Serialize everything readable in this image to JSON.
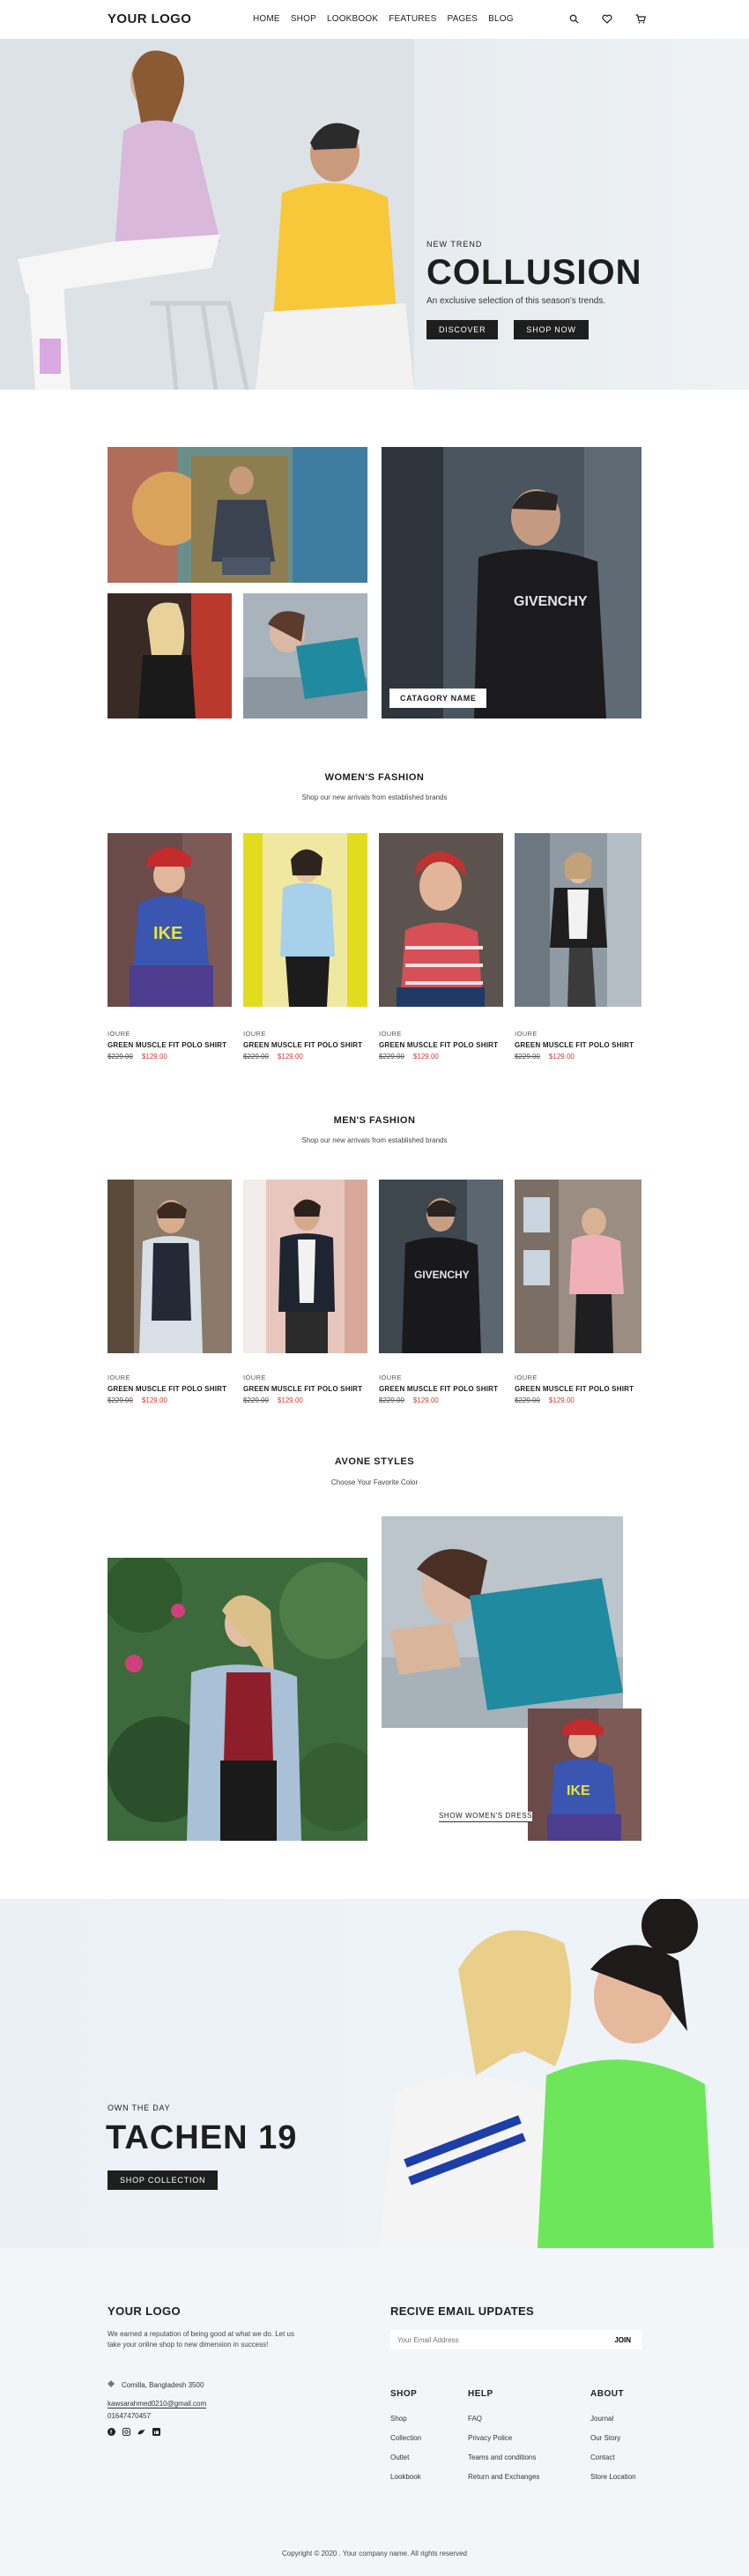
{
  "header": {
    "logo": "YOUR LOGO",
    "nav": [
      "HOME",
      "SHOP",
      "LOOKBOOK",
      "FEATURES",
      "PAGES",
      "BLOG"
    ],
    "icons": [
      "search-icon",
      "heart-icon",
      "cart-icon"
    ]
  },
  "hero": {
    "tag": "NEW TREND",
    "title": "COLLUSION",
    "subtitle": "An exclusive selection of this season's trends.",
    "discover_label": "DISCOVER",
    "shop_label": "SHOP NOW"
  },
  "categories": {
    "label": "CATAGORY NAME"
  },
  "women": {
    "title": "WOMEN'S FASHION",
    "subtitle": "Shop our new arrivals from established brands",
    "products": [
      {
        "brand": "IOURE",
        "name": "GREEN MUSCLE FIT POLO SHIRT",
        "old_price": "$229.00",
        "new_price": "$129.00"
      },
      {
        "brand": "IOURE",
        "name": "GREEN MUSCLE FIT POLO SHIRT",
        "old_price": "$229.00",
        "new_price": "$129.00"
      },
      {
        "brand": "IOURE",
        "name": "GREEN MUSCLE FIT POLO SHIRT",
        "old_price": "$229.00",
        "new_price": "$129.00"
      },
      {
        "brand": "IOURE",
        "name": "GREEN MUSCLE FIT POLO SHIRT",
        "old_price": "$229.00",
        "new_price": "$129.00"
      }
    ]
  },
  "men": {
    "title": "MEN'S FASHION",
    "subtitle": "Shop our new arrivals from established brands",
    "products": [
      {
        "brand": "IOURE",
        "name": "GREEN MUSCLE FIT POLO SHIRT",
        "old_price": "$229.00",
        "new_price": "$129.00"
      },
      {
        "brand": "IOURE",
        "name": "GREEN MUSCLE FIT POLO SHIRT",
        "old_price": "$229.00",
        "new_price": "$129.00"
      },
      {
        "brand": "IOURE",
        "name": "GREEN MUSCLE FIT POLO SHIRT",
        "old_price": "$229.00",
        "new_price": "$129.00"
      },
      {
        "brand": "IOURE",
        "name": "GREEN MUSCLE FIT POLO SHIRT",
        "old_price": "$229.00",
        "new_price": "$129.00"
      }
    ]
  },
  "styles": {
    "title": "AVONE STYLES",
    "subtitle": "Choose Your Favorite Color",
    "link": "SHOW WOMEN'S DRESS"
  },
  "banner": {
    "tag": "OWN THE DAY",
    "title": "TACHEN 19",
    "button": "SHOP COLLECTION"
  },
  "footer": {
    "logo": "YOUR LOGO",
    "about": "We earned a reputation of being good at what we do. Let us take your online shop to new dimension in success!",
    "address": "Comilla, Bangladesh 3500",
    "email": "kawsarahmed0210@gmail.com",
    "phone": "01647470457",
    "social_icons": [
      "facebook-icon",
      "instagram-icon",
      "twitter-icon",
      "linkedin-icon"
    ],
    "newsletter_title": "RECIVE EMAIL UPDATES",
    "newsletter_placeholder": "Your Email Address",
    "newsletter_button": "JOIN",
    "columns": [
      {
        "title": "SHOP",
        "links": [
          "Shop",
          "Collection",
          "Outlet",
          "Lookbook"
        ]
      },
      {
        "title": "HELP",
        "links": [
          "FAQ",
          "Privacy Police",
          "Teams and conditions",
          "Return and Exchanges"
        ]
      },
      {
        "title": "ABOUT",
        "links": [
          "Journal",
          "Our Story",
          "Contact",
          "Store Location"
        ]
      }
    ],
    "copyright": "Copyright © 2020 . Your company name. All rights reserved"
  },
  "colors": {
    "accent_dark": "#1e1e1e",
    "sale_red": "#d23a3a",
    "hero_bg": "#e3e8ec",
    "footer_bg": "#f3f6f9"
  }
}
